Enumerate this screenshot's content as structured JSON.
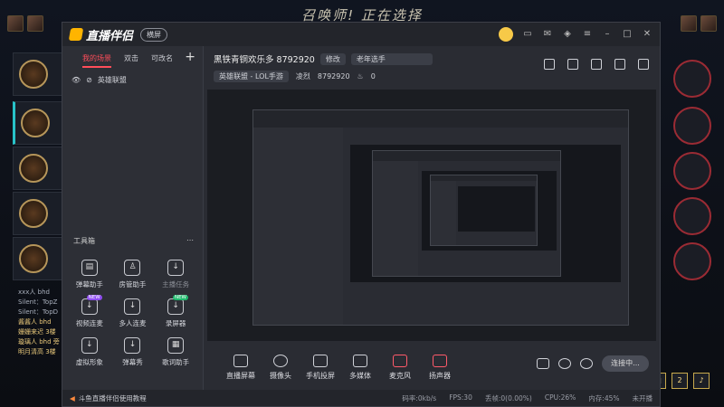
{
  "game": {
    "title": "召唤师! 正在选择",
    "chat_lines": [
      "xxx人 bhd",
      "Silent：TopZ",
      "Silent：TopD",
      "酱酱人 bhd",
      "姗姗来迟 3楼",
      "璇璃人 bhd 旁",
      "明月清高 3楼"
    ],
    "bottom_badge": "2"
  },
  "app": {
    "mode_label": "横屏",
    "tabs": [
      "我的场景",
      "双击",
      "可改名"
    ],
    "tab_plus": "+",
    "scene_name": "英雄联盟",
    "toolbox_label": "工具箱",
    "tools": [
      {
        "label": "弹幕助手",
        "icon": "danmu-icon",
        "badge": ""
      },
      {
        "label": "房管助手",
        "icon": "admin-icon",
        "badge": ""
      },
      {
        "label": "主播任务",
        "icon": "task-icon",
        "badge": "",
        "dim": true
      },
      {
        "label": "视频连麦",
        "icon": "video-link-icon",
        "badge": "NEW"
      },
      {
        "label": "多人连麦",
        "icon": "multi-link-icon",
        "badge": ""
      },
      {
        "label": "录屏器",
        "icon": "recorder-icon",
        "badge": "NEW"
      },
      {
        "label": "虚拟形象",
        "icon": "avatar-icon",
        "badge": ""
      },
      {
        "label": "弹幕秀",
        "icon": "danmu-show-icon",
        "badge": ""
      },
      {
        "label": "歌词助手",
        "icon": "lyrics-icon",
        "badge": ""
      }
    ]
  },
  "stream": {
    "title": "黑铁青铜欢乐多 8792920",
    "edit_label": "修改",
    "notice": "老年选手",
    "category": "英雄联盟 - LOL手游",
    "room_prefix": "凌烈",
    "room_id": "8792920",
    "heat": "0"
  },
  "bottombar": {
    "items": [
      "直播屏幕",
      "摄像头",
      "手机投屏",
      "多媒体",
      "麦克风",
      "扬声器"
    ],
    "live_label": "连接中..."
  },
  "status": {
    "help": "斗鱼直播伴侣使用教程",
    "speed": "码率:0kb/s",
    "fps": "FPS:30",
    "drop": "丢帧:0(0.00%)",
    "cpu": "CPU:26%",
    "mem": "内存:45%",
    "state": "未开播"
  }
}
